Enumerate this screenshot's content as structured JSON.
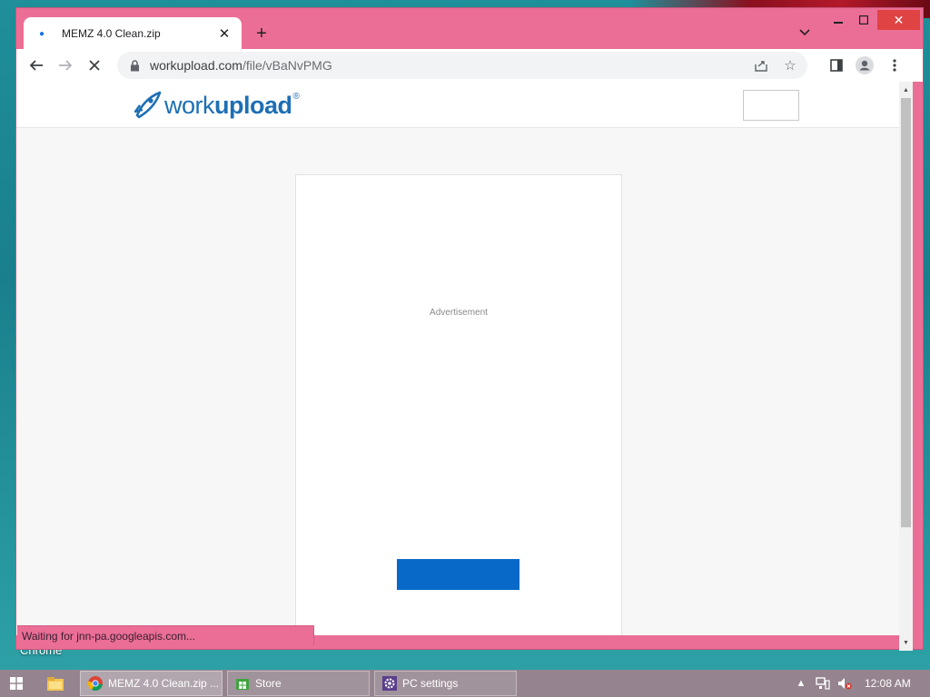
{
  "desktop": {
    "label": "Chrome"
  },
  "browser": {
    "tab": {
      "title": "MEMZ 4.0 Clean.zip"
    },
    "url": {
      "host": "workupload.com",
      "path": "/file/vBaNvPMG"
    },
    "status": "Waiting for jnn-pa.googleapis.com..."
  },
  "page": {
    "logo": {
      "text_light": "work",
      "text_bold": "upload",
      "mark": "®"
    },
    "ad_label": "Advertisement",
    "accent": "#0869c8"
  },
  "taskbar": {
    "tasks": [
      {
        "label": "MEMZ 4.0 Clean.zip ...",
        "icon": "chrome-icon"
      },
      {
        "label": "Store",
        "icon": "store-icon"
      },
      {
        "label": "PC settings",
        "icon": "gear-icon"
      }
    ],
    "clock": "12:08 AM"
  }
}
